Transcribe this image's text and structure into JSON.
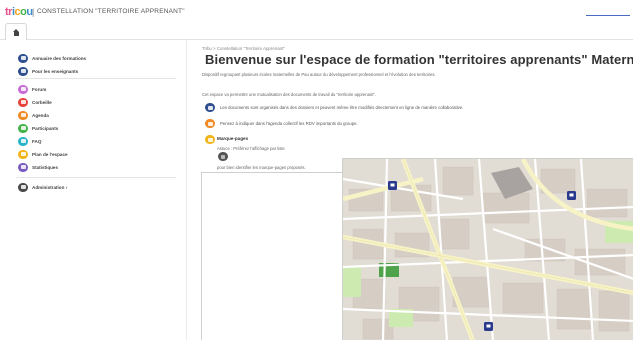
{
  "header": {
    "logo": {
      "part1": "tr",
      "part2": "i",
      "part3": "c",
      "part4": "o",
      "part5": "u"
    },
    "site_title": "CONSTELLATION \"TERRITOIRE APPRENANT\"",
    "separator": "|"
  },
  "colors": {
    "blue": "#2f4f8f",
    "pink": "#c86bd6",
    "red": "#e8423c",
    "orange": "#f08a24",
    "green": "#43b34a",
    "teal": "#28b4c8",
    "yellow": "#f2b519",
    "purple": "#7a5bc2",
    "gray": "#4a4a4a",
    "map_road": "#ffffff",
    "map_major_road": "#f7f3c6",
    "map_park": "#cdebb0",
    "map_block": "#d9d0c9",
    "map_marker": "#2a3a8f"
  },
  "sidebar": {
    "items": [
      {
        "label": "Annuaire des formations",
        "icon": "book-icon",
        "color": "#2f4f8f"
      },
      {
        "label": "Pour les enseignants",
        "icon": "users-icon",
        "color": "#2f4f8f"
      },
      {
        "label": "Forum",
        "icon": "chat-icon",
        "color": "#c86bd6"
      },
      {
        "label": "Corbeille",
        "icon": "trash-icon",
        "color": "#e8423c"
      },
      {
        "label": "Agenda",
        "icon": "calendar-icon",
        "color": "#f08a24"
      },
      {
        "label": "Participants",
        "icon": "people-icon",
        "color": "#43b34a"
      },
      {
        "label": "FAQ",
        "icon": "question-icon",
        "color": "#28b4c8"
      },
      {
        "label": "Plan de l'espace",
        "icon": "sitemap-icon",
        "color": "#f2b519"
      },
      {
        "label": "Statistiques",
        "icon": "stats-icon",
        "color": "#7a5bc2"
      },
      {
        "label": "Administration ›",
        "icon": "gear-icon",
        "color": "#4a4a4a"
      }
    ]
  },
  "main": {
    "breadcrumb": "Tribu > Constellation \"Territoire Apprenant\"",
    "title": "Bienvenue sur l'espace de formation \"territoires apprenants\" Maternelle",
    "desc1": "Dispositif regroupant plusieurs écoles maternelles de Pau autour du développement professionnel et l'évolution des territoires.",
    "desc2": "Cet espace va permettre une mutualisation des documents de travail du \"territoire apprenant\".",
    "features": [
      {
        "text": "Les documents sont organisés dans des dossiers et peuvent même être modifiés directement en ligne de manière collaborative.",
        "icon": "document-icon",
        "color": "#2f4f8f"
      },
      {
        "text": "Pensez à indiquer dans l'agenda collectif les RDV importants du groupe.",
        "icon": "calendar-icon",
        "color": "#f08a24"
      },
      {
        "text": "",
        "icon": "bookmark-icon",
        "color": "#f2b519"
      }
    ],
    "bookmarks_title": "Marque-pages",
    "bookmarks_sub": "Astuce : Préférez l'affichage par liste",
    "bookmarks_help": "pour bien identifier les marque-pages proposés."
  }
}
